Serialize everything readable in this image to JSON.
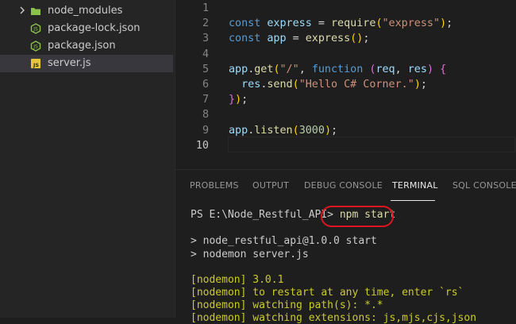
{
  "explorer": {
    "items": [
      {
        "label": "node_modules",
        "type": "folder"
      },
      {
        "label": "package-lock.json",
        "type": "node-json"
      },
      {
        "label": "package.json",
        "type": "node-json"
      },
      {
        "label": "server.js",
        "type": "js"
      }
    ],
    "selected": "server.js"
  },
  "editor": {
    "current_line": "10",
    "lines": [
      {
        "n": "1",
        "tokens": []
      },
      {
        "n": "2",
        "tokens": [
          [
            "k",
            "const"
          ],
          [
            "t",
            " "
          ],
          [
            "v",
            "express"
          ],
          [
            "t",
            " = "
          ],
          [
            "f",
            "require"
          ],
          [
            "y",
            "("
          ],
          [
            "s",
            "\"express\""
          ],
          [
            "y",
            ")"
          ],
          [
            "t",
            ";"
          ]
        ]
      },
      {
        "n": "3",
        "tokens": [
          [
            "k",
            "const"
          ],
          [
            "t",
            " "
          ],
          [
            "v",
            "app"
          ],
          [
            "t",
            " = "
          ],
          [
            "f",
            "express"
          ],
          [
            "y",
            "()"
          ],
          [
            "t",
            ";"
          ]
        ]
      },
      {
        "n": "4",
        "tokens": []
      },
      {
        "n": "5",
        "tokens": [
          [
            "v",
            "app"
          ],
          [
            "t",
            "."
          ],
          [
            "f",
            "get"
          ],
          [
            "y",
            "("
          ],
          [
            "s",
            "\"/\""
          ],
          [
            "t",
            ", "
          ],
          [
            "k",
            "function"
          ],
          [
            "t",
            " "
          ],
          [
            "p",
            "("
          ],
          [
            "v",
            "req"
          ],
          [
            "t",
            ", "
          ],
          [
            "v",
            "res"
          ],
          [
            "p",
            ")"
          ],
          [
            "t",
            " "
          ],
          [
            "p",
            "{"
          ]
        ]
      },
      {
        "n": "6",
        "tokens": [
          [
            "t",
            "  "
          ],
          [
            "v",
            "res"
          ],
          [
            "t",
            "."
          ],
          [
            "f",
            "send"
          ],
          [
            "y",
            "("
          ],
          [
            "s",
            "\"Hello C# Corner.\""
          ],
          [
            "y",
            ")"
          ],
          [
            "t",
            ";"
          ]
        ]
      },
      {
        "n": "7",
        "tokens": [
          [
            "p",
            "}"
          ],
          [
            "y",
            ")"
          ],
          [
            "t",
            ";"
          ]
        ]
      },
      {
        "n": "8",
        "tokens": []
      },
      {
        "n": "9",
        "tokens": [
          [
            "v",
            "app"
          ],
          [
            "t",
            "."
          ],
          [
            "f",
            "listen"
          ],
          [
            "y",
            "("
          ],
          [
            "n",
            "3000"
          ],
          [
            "y",
            ")"
          ],
          [
            "t",
            ";"
          ]
        ]
      },
      {
        "n": "10",
        "tokens": []
      }
    ]
  },
  "panel": {
    "tabs": [
      {
        "label": "PROBLEMS",
        "active": false
      },
      {
        "label": "OUTPUT",
        "active": false
      },
      {
        "label": "DEBUG CONSOLE",
        "active": false
      },
      {
        "label": "TERMINAL",
        "active": true
      },
      {
        "label": "SQL CONSOLE",
        "active": false
      }
    ],
    "terminal": {
      "prompt": "PS E:\\Node_Restful_API>",
      "command": "npm start",
      "output": [
        {
          "text": "> node_restful_api@1.0.0 start",
          "color": "default"
        },
        {
          "text": "> nodemon server.js",
          "color": "default"
        },
        {
          "text": "",
          "color": "default"
        },
        {
          "text": "[nodemon] 3.0.1",
          "color": "yellow"
        },
        {
          "text": "[nodemon] to restart at any time, enter `rs`",
          "color": "yellow"
        },
        {
          "text": "[nodemon] watching path(s): *.*",
          "color": "yellow"
        },
        {
          "text": "[nodemon] watching extensions: js,mjs,cjs,json",
          "color": "yellow"
        }
      ]
    }
  },
  "colors": {
    "highlight_annotation": "#e0141e",
    "nodemon_yellow": "#cccc29"
  }
}
